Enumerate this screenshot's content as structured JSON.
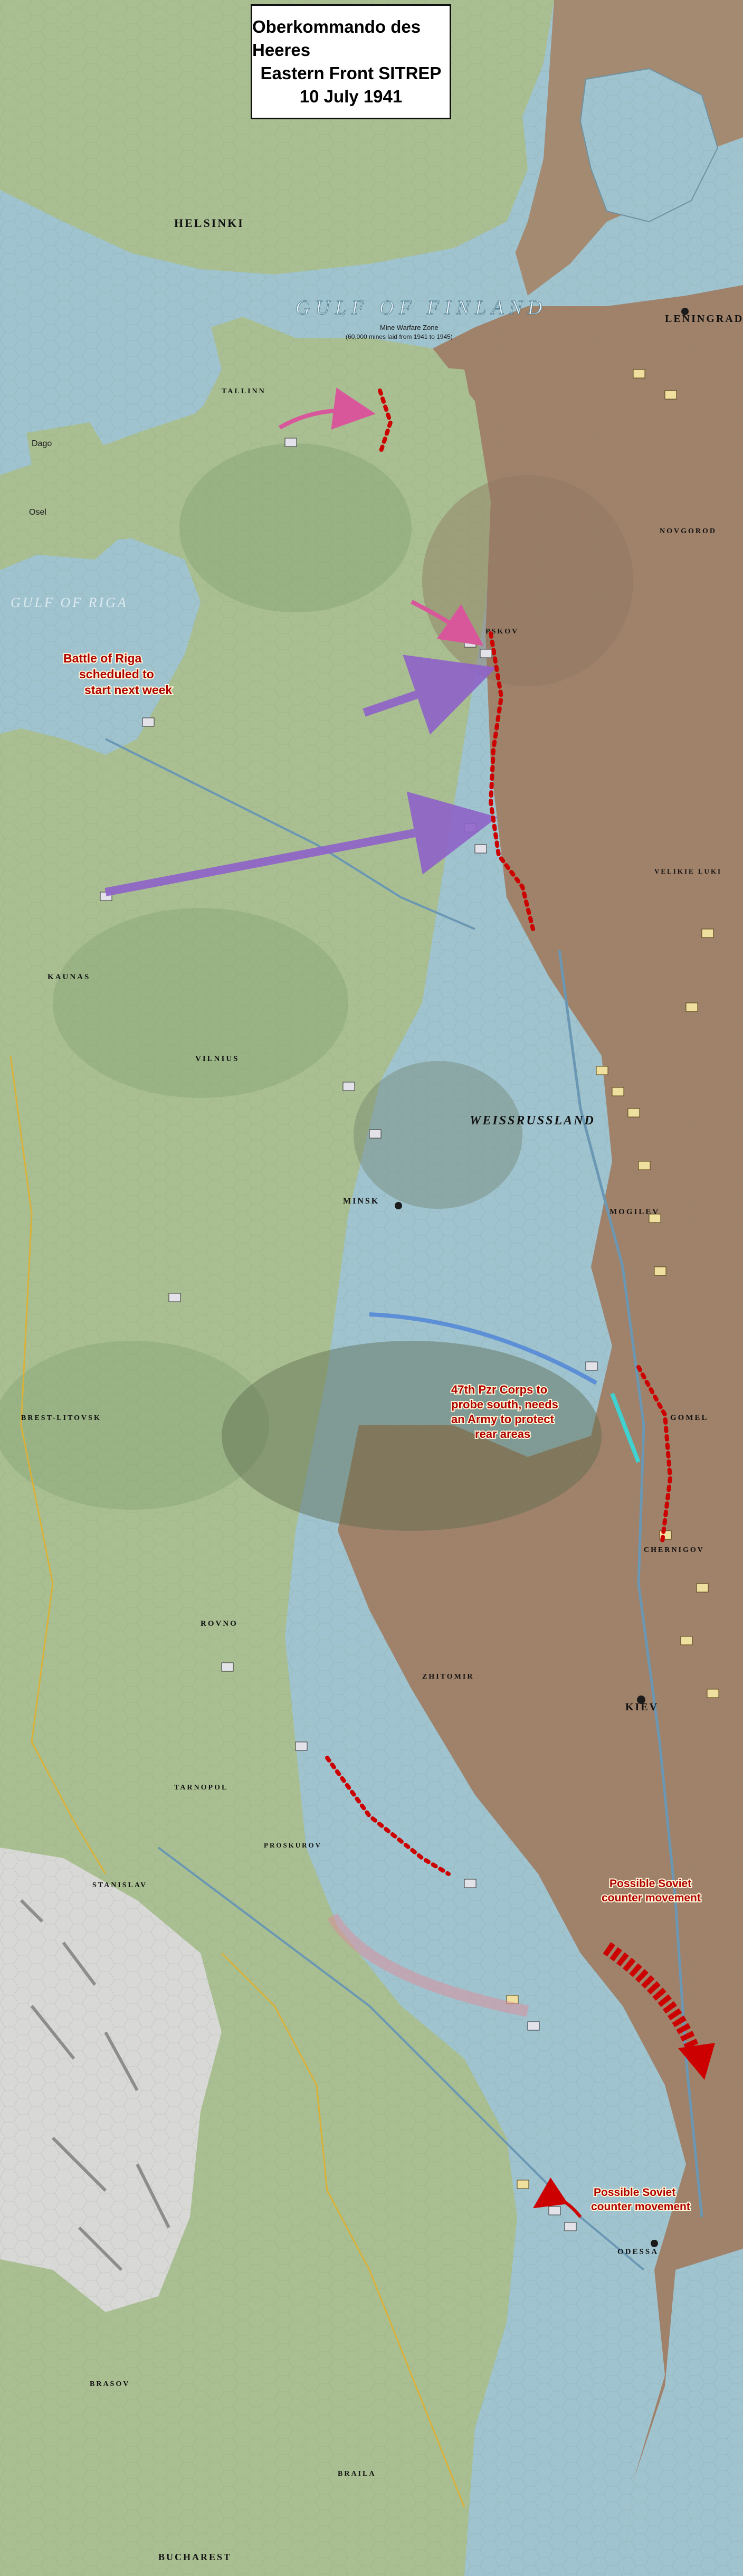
{
  "title": {
    "line1": "Oberkommando des Heeres",
    "line2": "Eastern Front SITREP",
    "line3": "10 July 1941"
  },
  "annotations": {
    "riga": [
      "Battle of Riga",
      "scheduled to",
      "start next week"
    ],
    "panzer": [
      "47th Pzr Corps to",
      "probe south, needs",
      "an Army to protect",
      "rear areas"
    ],
    "soviet1": [
      "Possible Soviet",
      "counter movement"
    ],
    "soviet2": [
      "Possible Soviet",
      "counter movement"
    ]
  },
  "mine_zone": {
    "line1": "Mine Warfare Zone",
    "line2": "(60,000 mines laid from 1941 to 1945)"
  },
  "seas": {
    "finland": "GULF OF FINLAND",
    "riga": "GULF OF RIGA"
  },
  "regions": {
    "weissrussland": "WEISSRUSSLAND"
  },
  "cities": {
    "helsinki": "HELSINKI",
    "leningrad": "LENINGRAD",
    "pskov": "PSKOV",
    "minsk": "MINSK",
    "vilnius": "VILNIUS",
    "kaunas": "KAUNAS",
    "mogilev": "MOGILEV",
    "gomel": "GOMEL",
    "chernigov": "CHERNIGOV",
    "kiev": "KIEV",
    "brest": "BREST-LITOVSK",
    "rovno": "ROVNO",
    "tarnopol": "TARNOPOL",
    "stanislav": "STANISLAV",
    "odessa": "ODESSA",
    "brasov": "BRASOV",
    "braila": "BRAILA",
    "bucharest": "BUCHAREST",
    "tallinn": "TALLINN",
    "novgorod": "NOVGOROD",
    "velikie_luki": "VELIKIE LUKI",
    "zhitomir": "ZHITOMIR",
    "proskurov": "PROSKUROV",
    "dago": "Dago",
    "osel": "Osel"
  },
  "colors": {
    "sea": "#9fc3cf",
    "axis_land": "#a9bf91",
    "soviet_land": "#a0816a",
    "note_red": "#cc0000",
    "arrow_purple": "#8f63c9",
    "arrow_pink": "#d8579b",
    "arrow_blue": "#5d8fd6",
    "arrow_cyan": "#40d1d1"
  }
}
